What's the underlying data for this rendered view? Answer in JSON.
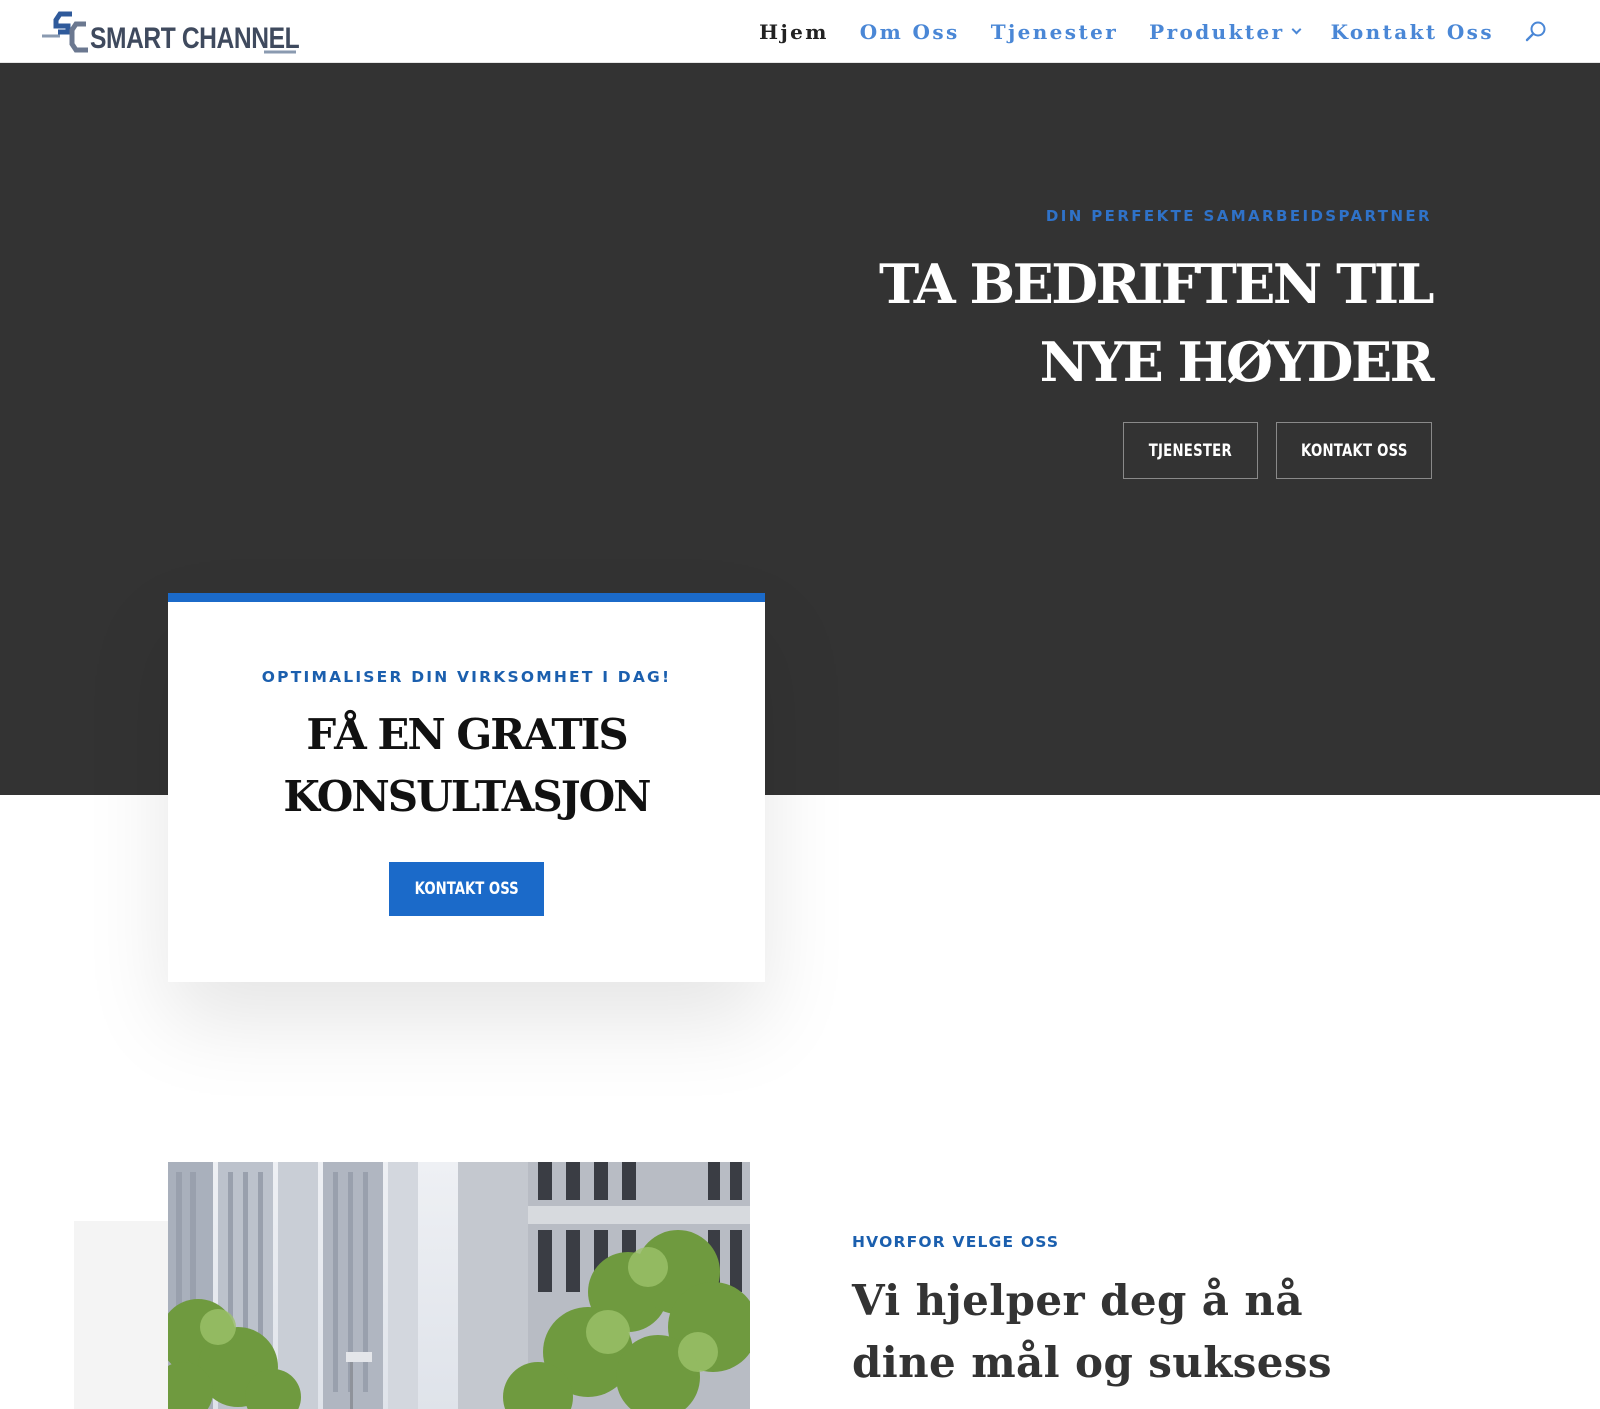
{
  "header": {
    "logo_text": "SMART CHANNEL",
    "nav": [
      {
        "label": "Hjem",
        "active": true
      },
      {
        "label": "Om Oss",
        "active": false
      },
      {
        "label": "Tjenester",
        "active": false
      },
      {
        "label": "Produkter",
        "active": false,
        "has_dropdown": true
      },
      {
        "label": "Kontakt Oss",
        "active": false
      }
    ],
    "search_icon": "search-icon"
  },
  "hero": {
    "eyebrow": "DIN PERFEKTE SAMARBEIDSPARTNER",
    "title": "TA BEDRIFTEN TIL NYE HØYDER",
    "buttons": {
      "tjenester": "TJENESTER",
      "kontakt": "KONTAKT OSS"
    }
  },
  "cta": {
    "eyebrow": "OPTIMALISER DIN VIRKSOMHET I DAG!",
    "title": "FÅ EN GRATIS KONSULTASJON",
    "button": "KONTAKT OSS"
  },
  "why": {
    "eyebrow": "HVORFOR VELGE OSS",
    "title": "Vi hjelper deg å nå dine mål og suksess"
  },
  "colors": {
    "accent": "#1b6ac9",
    "nav_link": "#4a87d6",
    "hero_bg": "#333333",
    "text_dark": "#111111"
  }
}
